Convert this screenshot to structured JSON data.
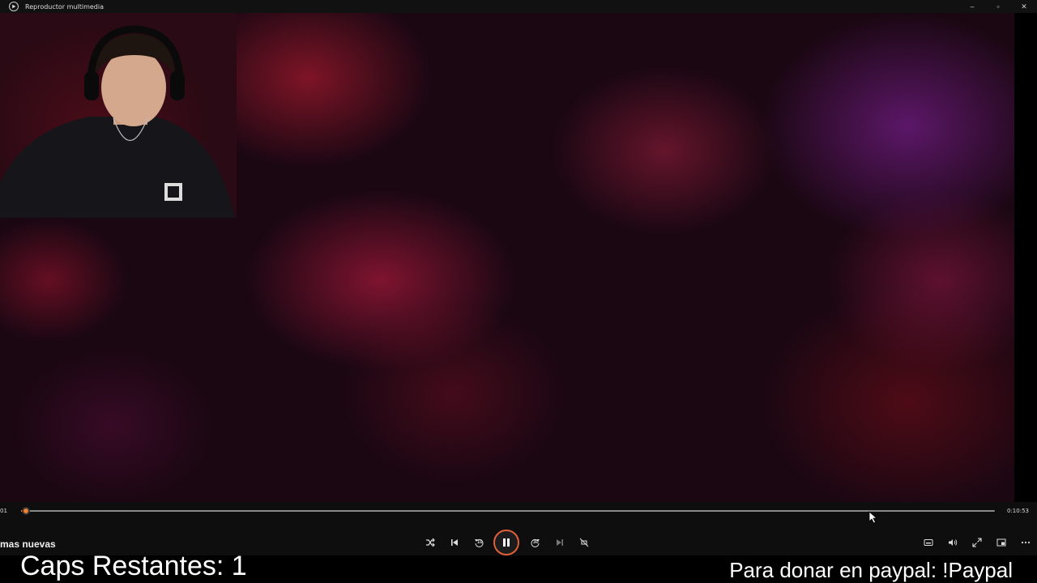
{
  "window": {
    "title": "Reproductor multimedia",
    "minimize": "–",
    "restore": "▫",
    "close": "✕"
  },
  "player": {
    "time_elapsed": "01",
    "time_total": "0:10:53",
    "progress_fraction": 0.005,
    "playlist_label": "mas nuevas",
    "skip_back_seconds": "10",
    "skip_forward_seconds": "30"
  },
  "overlay": {
    "caps_text": "Caps Restantes: 1",
    "donate_text": "Para donar en paypal: !Paypal"
  },
  "colors": {
    "accent": "#f08030",
    "accent_ring": "#e0603a"
  }
}
